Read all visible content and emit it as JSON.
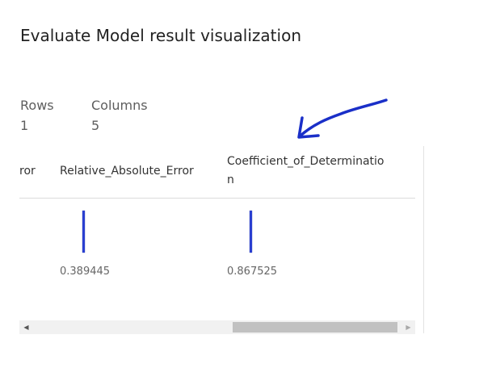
{
  "header": {
    "title": "Evaluate Model result visualization"
  },
  "stats": {
    "rows_label": "Rows",
    "rows_value": "1",
    "columns_label": "Columns",
    "columns_value": "5"
  },
  "table": {
    "columns": [
      {
        "label": "ror"
      },
      {
        "label": "Relative_Absolute_Error"
      },
      {
        "label_line1": "Coefficient_of_Determinatio",
        "label_line2": "n"
      }
    ],
    "row": {
      "relative_absolute_error": "0.389445",
      "coefficient_of_determination": "0.867525"
    }
  },
  "scrollbar": {
    "left_arrow": "◀",
    "right_arrow": "▶"
  },
  "annotation": {
    "icon": "hand-drawn-arrow-icon",
    "color": "#1a2fc8"
  }
}
